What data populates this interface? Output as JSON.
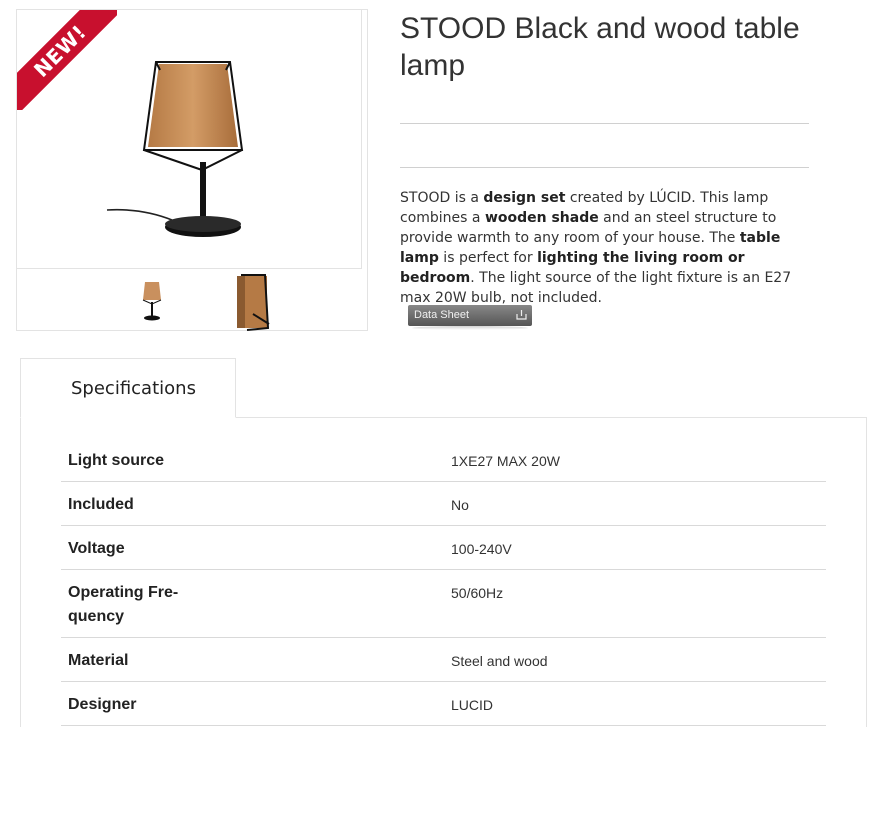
{
  "product": {
    "badge": "NEW!",
    "title": "STOOD Black and wood table lamp",
    "description": {
      "p1": "STOOD is a ",
      "b1": "design set",
      "p2": " created by LÚCID. This lamp combines a ",
      "b2": "wooden shade",
      "p3": " and an steel structure to provide warmth to any room of your house. The ",
      "b3": "table lamp",
      "p4": " is perfect for ",
      "b4": "light­ing the living room or bedroom",
      "p5": ". The light source of the light fixture is an E27 max 20W bulb, not included."
    },
    "datasheet_label": "Data Sheet"
  },
  "tabs": [
    {
      "label": "Specifications",
      "active": true
    }
  ],
  "specs": [
    {
      "label": "Light source",
      "value": "1XE27 MAX 20W"
    },
    {
      "label": "Included",
      "value": "No"
    },
    {
      "label": "Voltage",
      "value": "100-240V"
    },
    {
      "label": "Operating Fre­quency",
      "value": "50/60Hz"
    },
    {
      "label": "Material",
      "value": "Steel and wood"
    },
    {
      "label": "Designer",
      "value": "LUCID"
    }
  ],
  "colors": {
    "badge": "#c8102e",
    "wood": "#c9905e",
    "steel": "#1a1a1a"
  },
  "icons": {
    "download": "download-icon"
  }
}
